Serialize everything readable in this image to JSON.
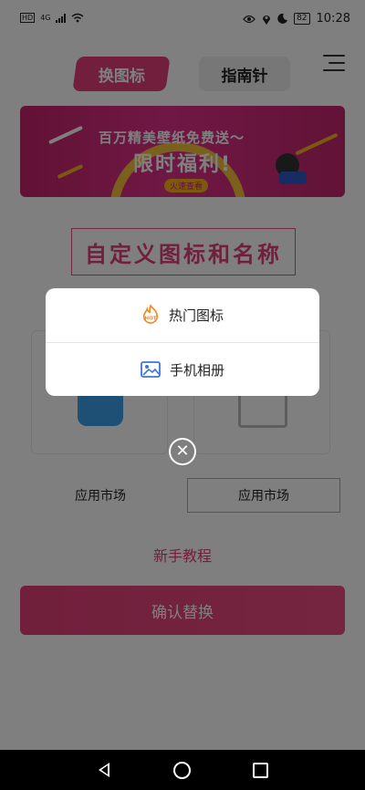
{
  "status_bar": {
    "carrier": "HD",
    "network": "4G",
    "battery": "82",
    "time": "10:28"
  },
  "header": {
    "tabs": [
      {
        "label": "换图标",
        "active": true
      },
      {
        "label": "指南针",
        "active": false
      }
    ],
    "menu_icon": "hamburger-menu-icon"
  },
  "banner": {
    "line1": "百万精美壁纸免费送～",
    "line2": "限时福利!",
    "badge": "火速查看"
  },
  "main": {
    "title": "自定义图标和名称",
    "app_label": "应用市场",
    "name_value": "应用市场",
    "tutorial": "新手教程",
    "confirm": "确认替换"
  },
  "modal": {
    "options": [
      {
        "label": "热门图标",
        "icon": "hot-icon",
        "icon_badge": "HOT"
      },
      {
        "label": "手机相册",
        "icon": "gallery-icon"
      }
    ],
    "close_icon": "close-circle-icon"
  },
  "colors": {
    "accent": "#e23f78",
    "overlay": "rgba(0,0,0,0.5)",
    "hot_orange": "#f08a24",
    "album_blue": "#3a74e0"
  },
  "nav_bar": {
    "back": "back-icon",
    "home": "home-icon",
    "recent": "recent-apps-icon"
  }
}
